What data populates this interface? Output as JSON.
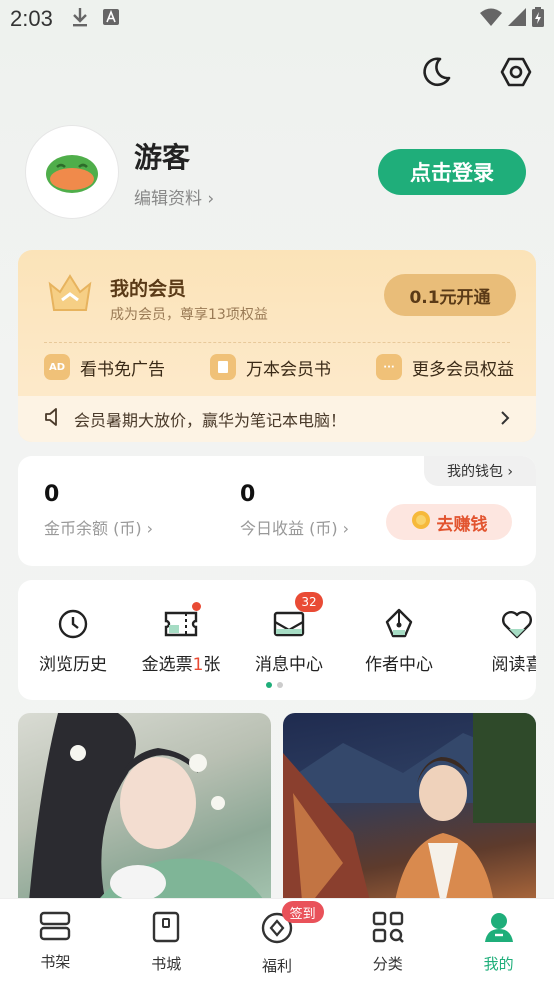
{
  "status_bar": {
    "time": "2:03"
  },
  "profile": {
    "username": "游客",
    "edit_label": "编辑资料 ›",
    "login_label": "点击登录"
  },
  "vip": {
    "title": "我的会员",
    "subtitle": "成为会员，尊享13项权益",
    "open_label": "0.1元开通",
    "benefits": [
      {
        "icon": "ad-icon",
        "label": "看书免广告"
      },
      {
        "icon": "book-icon",
        "label": "万本会员书"
      },
      {
        "icon": "more-icon",
        "label": "更多会员权益"
      }
    ],
    "notice": "会员暑期大放价，赢华为笔记本电脑！"
  },
  "wallet": {
    "tag": "我的钱包 ›",
    "coins_value": "0",
    "coins_label": "金币余额 (币) ›",
    "today_value": "0",
    "today_label": "今日收益 (币) ›",
    "earn_label": "去赚钱"
  },
  "shortcuts": [
    {
      "label": "浏览历史"
    },
    {
      "label_prefix": "金选票",
      "label_count": "1",
      "label_suffix": "张"
    },
    {
      "label": "消息中心",
      "badge": "32"
    },
    {
      "label": "作者中心"
    },
    {
      "label": "阅读喜"
    }
  ],
  "tabbar": {
    "items": [
      {
        "label": "书架"
      },
      {
        "label": "书城"
      },
      {
        "label": "福利",
        "badge": "签到"
      },
      {
        "label": "分类"
      },
      {
        "label": "我的"
      }
    ]
  },
  "colors": {
    "accent": "#1fae7a",
    "vip_bg": "#fbe3b8",
    "badge_red": "#e94b35"
  }
}
